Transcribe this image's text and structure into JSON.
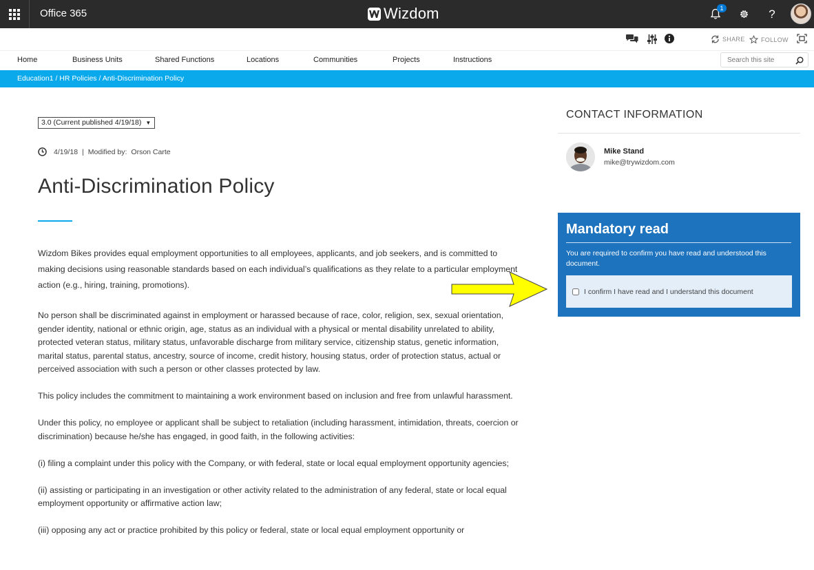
{
  "suite_bar": {
    "app_title": "Office 365",
    "brand": "Wizdom",
    "notification_count": "1",
    "help_label": "?"
  },
  "action_bar": {
    "share_label": "SHARE",
    "follow_label": "FOLLOW"
  },
  "nav": {
    "items": [
      "Home",
      "Business Units",
      "Shared Functions",
      "Locations",
      "Communities",
      "Projects",
      "Instructions"
    ],
    "search_placeholder": "Search this site"
  },
  "breadcrumb": {
    "text": "Education1 /  HR Policies / Anti-Discrimination Policy"
  },
  "document": {
    "version": "3.0 (Current published 4/19/18)",
    "date": "4/19/18",
    "separator": "|",
    "modified_label": "Modified by:",
    "modified_by": "Orson Carte",
    "title": "Anti-Discrimination Policy",
    "paragraphs": [
      "Wizdom Bikes provides equal employment opportunities to all employees, applicants, and job seekers, and is committed to making decisions using reasonable standards based on each individual’s qualifications as they relate to a particular employment action (e.g., hiring, training, promotions).",
      "No person shall be discriminated against in employment or harassed because of race, color, religion, sex, sexual orientation, gender identity, national or ethnic origin, age, status as an individual with a physical or mental disability unrelated to ability, protected veteran status, military status, unfavorable discharge from military service, citizenship status, genetic information, marital status, parental status, ancestry, source of income, credit history, housing status, order of protection status, actual or perceived association with such a person or other classes protected by law.",
      "This policy includes the commitment to maintaining a work environment based on inclusion and free from unlawful harassment.",
      "Under this policy, no employee or applicant shall be subject to retaliation (including harassment, intimidation, threats, coercion or discrimination) because he/she has engaged, in good faith, in the following activities:",
      "(i) filing a complaint under this policy with the Company, or with federal, state or local equal employment opportunity agencies;",
      "(ii) assisting or participating in an investigation or other activity related to the administration of any federal, state or local equal employment opportunity or affirmative action law;",
      "(iii) opposing any act or practice prohibited by this policy or federal, state or local equal employment opportunity or"
    ]
  },
  "contact": {
    "heading": "CONTACT INFORMATION",
    "name": "Mike Stand",
    "email": "mike@trywizdom.com"
  },
  "mandatory": {
    "heading": "Mandatory read",
    "description": "You are required to confirm you have read and understood this document.",
    "confirm_label": "I confirm I have read and I understand this document",
    "confirmed": false
  },
  "colors": {
    "suite_bar": "#2b2b2b",
    "breadcrumb": "#0aa9ec",
    "mandatory_panel": "#1e73be",
    "arrow": "#ffff00"
  }
}
